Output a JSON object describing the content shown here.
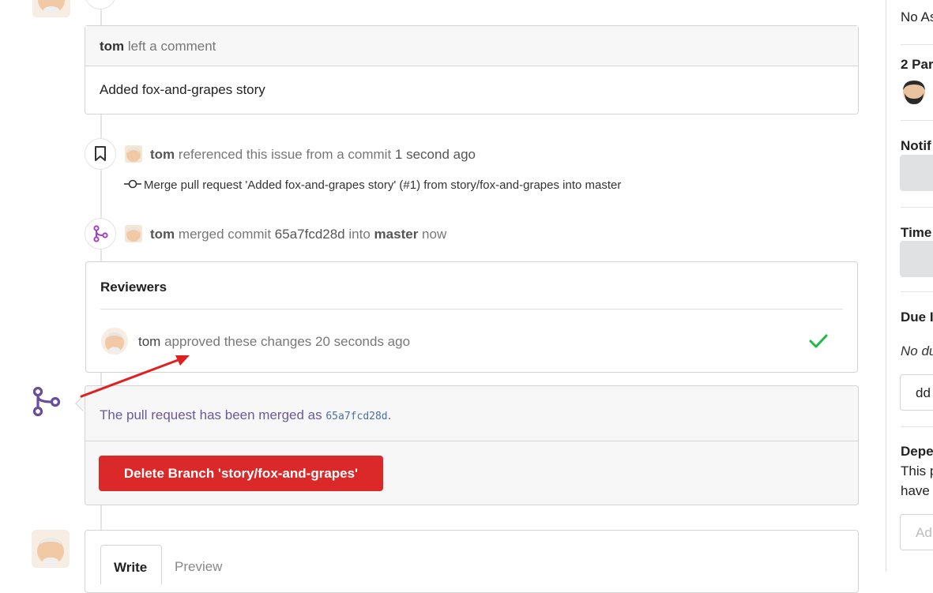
{
  "comment": {
    "author": "tom",
    "action": "left a comment",
    "body": "Added fox-and-grapes story"
  },
  "reference_event": {
    "author": "tom",
    "action": "referenced this issue from a commit",
    "time": "1 second ago",
    "commit_message": "Merge pull request 'Added fox-and-grapes story' (#1) from story/fox-and-grapes into master"
  },
  "merge_event": {
    "author": "tom",
    "action": "merged commit",
    "commit": "65a7fcd28d",
    "into": "into",
    "branch": "master",
    "time": "now"
  },
  "reviewers": {
    "title": "Reviewers",
    "reviewer": "tom",
    "status": "approved these changes 20 seconds ago"
  },
  "merged": {
    "text": "The pull request has been merged as",
    "commit": "65a7fcd28d",
    "period": ".",
    "delete_button": "Delete Branch 'story/fox-and-grapes'"
  },
  "editor": {
    "write_tab": "Write",
    "preview_tab": "Preview"
  },
  "sidebar": {
    "assignees": "No As",
    "participants": "2 Par",
    "notifications": "Notif",
    "time_tracking": "Time",
    "due_date": "Due I",
    "due_date_value": "No du",
    "due_date_input": "dd",
    "dependencies": "Depe",
    "dependencies_text_1": "This p",
    "dependencies_text_2": "have",
    "add_dependency_placeholder": "Ad"
  },
  "colors": {
    "merge_purple": "#7a4fa8",
    "danger_red": "#db2828",
    "approve_green": "#21ba45",
    "annotation_arrow": "#e02020"
  }
}
